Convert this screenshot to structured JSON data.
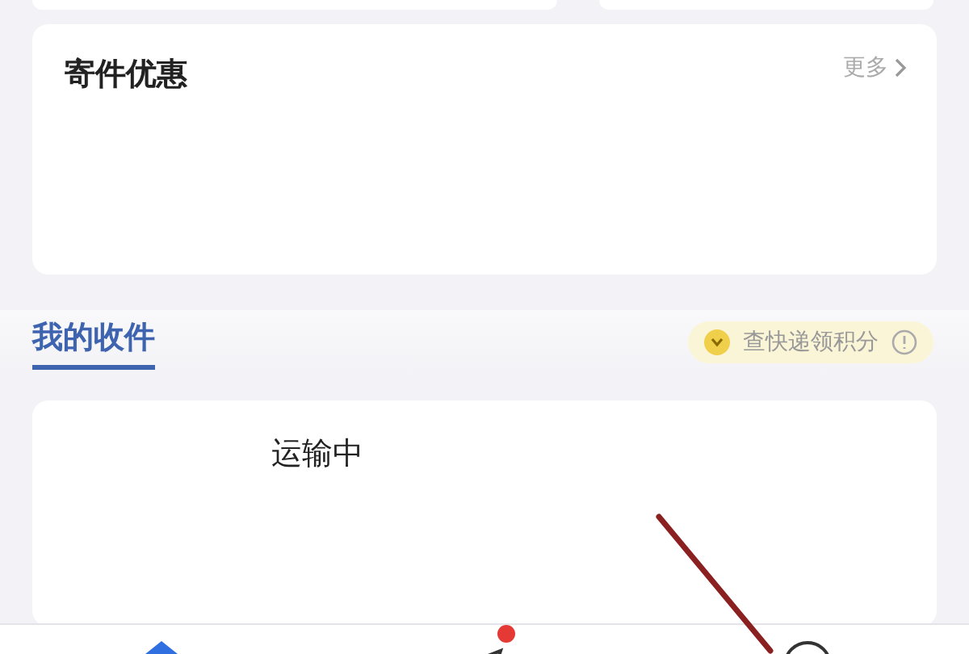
{
  "promo_card": {
    "title": "寄件优惠",
    "more_link": "更多"
  },
  "section_tabs": [
    {
      "label": "我的收件",
      "selected": true
    }
  ],
  "points_banner": {
    "text": "查快递领积分"
  },
  "parcel_card": {
    "status": "运输中"
  },
  "bottom_nav": [
    {
      "kind": "home",
      "badge": false
    },
    {
      "kind": "send",
      "badge": true
    },
    {
      "kind": "profile",
      "badge": false
    }
  ]
}
